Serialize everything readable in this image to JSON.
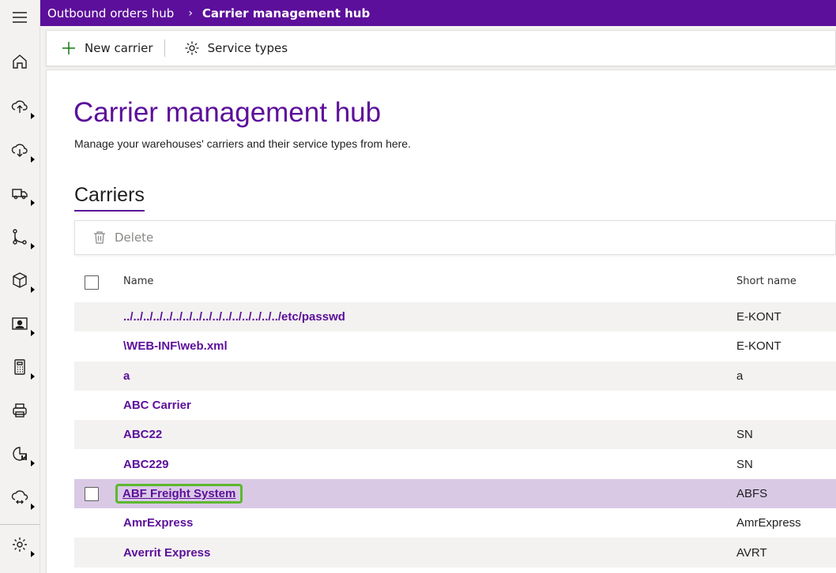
{
  "breadcrumb": {
    "parent": "Outbound orders hub",
    "separator": "›",
    "current": "Carrier management hub"
  },
  "commands": {
    "new_carrier": "New carrier",
    "service_types": "Service types",
    "delete": "Delete"
  },
  "page": {
    "title": "Carrier management hub",
    "subtitle": "Manage your warehouses' carriers and their service types from here.",
    "section_title": "Carriers"
  },
  "table": {
    "headers": {
      "name": "Name",
      "short_name": "Short name"
    },
    "rows": [
      {
        "name": "../../../../../../../../../../../../../../../../etc/passwd",
        "short_name": "E-KONT"
      },
      {
        "name": "\\WEB-INF\\web.xml",
        "short_name": "E-KONT"
      },
      {
        "name": "a",
        "short_name": "a"
      },
      {
        "name": "ABC Carrier",
        "short_name": ""
      },
      {
        "name": "ABC22",
        "short_name": "SN"
      },
      {
        "name": "ABC229",
        "short_name": "SN"
      },
      {
        "name": "ABF Freight System",
        "short_name": "ABFS"
      },
      {
        "name": "AmrExpress",
        "short_name": "AmrExpress"
      },
      {
        "name": "Averrit Express",
        "short_name": "AVRT"
      }
    ]
  },
  "nav_icons": [
    "hamburger-icon",
    "home-icon",
    "inbound-icon",
    "outbound-icon",
    "truck-icon",
    "flow-icon",
    "box-icon",
    "contact-card-icon",
    "calculator-icon",
    "printer-icon",
    "report-icon",
    "cloud-sync-icon",
    "settings-icon"
  ],
  "colors": {
    "brand": "#5c0f9a",
    "selected_row": "#d9c9e5",
    "focus_ring": "#5cb82d",
    "stripe": "#f3f2f1"
  }
}
